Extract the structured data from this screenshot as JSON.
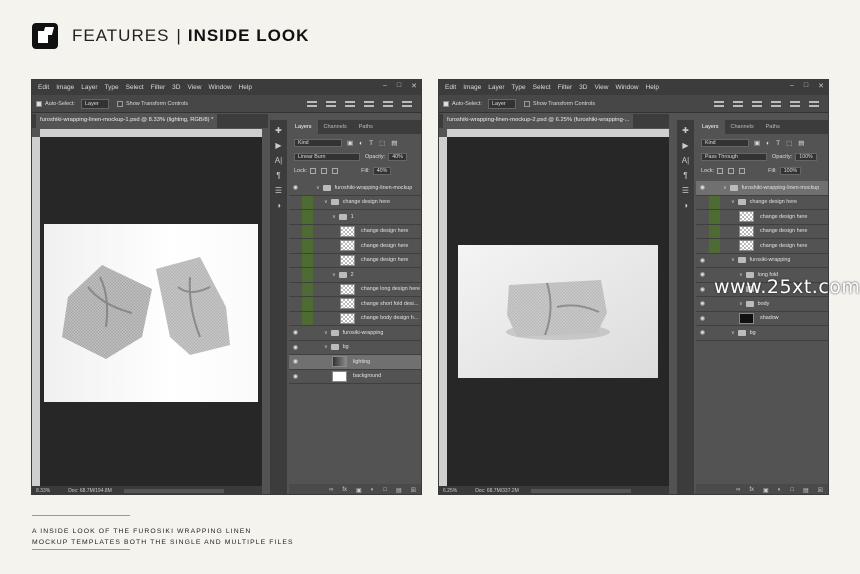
{
  "header": {
    "features": "FEATURES",
    "separator": "|",
    "inside_look": "INSIDE LOOK"
  },
  "menu": [
    "Edit",
    "Image",
    "Layer",
    "Type",
    "Select",
    "Filter",
    "3D",
    "View",
    "Window",
    "Help"
  ],
  "window_controls": [
    "–",
    "□",
    "✕"
  ],
  "options": {
    "auto_select": "Auto-Select:",
    "target": "Layer",
    "show_transform": "Show Transform Controls"
  },
  "panel_tabs": [
    "Layers",
    "Channels",
    "Paths"
  ],
  "filter_kind": "Kind",
  "lock_label": "Lock:",
  "fill_label": "Fill:",
  "opacity_label": "Opacity:",
  "window1": {
    "doc_tab": "furoshiki-wrapping-linen-mockup-1.psd @ 8.33% (lighting, RGB/8) *",
    "blend_mode": "Linear Burn",
    "opacity": "40%",
    "fill": "40%",
    "zoom": "8.33%",
    "doc_size": "Doc: 68.7M/194.8M",
    "layers": [
      {
        "name": "furoshiki-wrapping-linen-mockup",
        "type": "folder",
        "indent": 0,
        "eye": true
      },
      {
        "name": "change design here",
        "type": "folder",
        "indent": 1,
        "eye": false,
        "green": true
      },
      {
        "name": "1",
        "type": "folder",
        "indent": 2,
        "eye": false,
        "green": true
      },
      {
        "name": "change design here",
        "type": "smart",
        "indent": 3,
        "eye": false,
        "green": true
      },
      {
        "name": "change design here",
        "type": "smart",
        "indent": 3,
        "eye": false,
        "green": true
      },
      {
        "name": "change design here",
        "type": "smart",
        "indent": 3,
        "eye": false,
        "green": true
      },
      {
        "name": "2",
        "type": "folder",
        "indent": 2,
        "eye": false,
        "green": true
      },
      {
        "name": "change long design here",
        "type": "smart",
        "indent": 3,
        "eye": false,
        "green": true
      },
      {
        "name": "change short fold desi...",
        "type": "smart",
        "indent": 3,
        "eye": false,
        "green": true
      },
      {
        "name": "change body design h...",
        "type": "smart",
        "indent": 3,
        "eye": false,
        "green": true
      },
      {
        "name": "furosiki-wrapping",
        "type": "folder",
        "indent": 1,
        "eye": true
      },
      {
        "name": "bg",
        "type": "folder",
        "indent": 1,
        "eye": true
      },
      {
        "name": "lighting",
        "type": "dark",
        "indent": 2,
        "eye": true,
        "selected": true
      },
      {
        "name": "background",
        "type": "white",
        "indent": 2,
        "eye": true
      }
    ]
  },
  "window2": {
    "doc_tab": "furoshiki-wrapping-linen-mockup-2.psd @ 6.25% (furoshiki-wrapping-...",
    "blend_mode": "Pass Through",
    "opacity": "100%",
    "fill": "100%",
    "zoom": "6.25%",
    "doc_size": "Doc: 68.7M/337.2M",
    "layers": [
      {
        "name": "furoshiki-wrapping-linen-mockup",
        "type": "folder",
        "indent": 0,
        "eye": true,
        "selected": true
      },
      {
        "name": "change design here",
        "type": "folder",
        "indent": 1,
        "eye": false,
        "green": true
      },
      {
        "name": "change design here",
        "type": "smart",
        "indent": 2,
        "eye": false,
        "green": true
      },
      {
        "name": "change design here",
        "type": "smart",
        "indent": 2,
        "eye": false,
        "green": true
      },
      {
        "name": "change design here",
        "type": "smart",
        "indent": 2,
        "eye": false,
        "green": true
      },
      {
        "name": "furosiki-wrapping",
        "type": "folder",
        "indent": 1,
        "eye": true
      },
      {
        "name": "long fold",
        "type": "folder",
        "indent": 2,
        "eye": true
      },
      {
        "name": "",
        "type": "folder",
        "indent": 2,
        "eye": true
      },
      {
        "name": "body",
        "type": "folder",
        "indent": 2,
        "eye": true
      },
      {
        "name": "shadow",
        "type": "blk",
        "indent": 2,
        "eye": true
      },
      {
        "name": "bg",
        "type": "folder",
        "indent": 1,
        "eye": true
      }
    ]
  },
  "tools": [
    "✚",
    "▶",
    "A|",
    "¶",
    "☰",
    "◑"
  ],
  "panel_bottom_icons": [
    "∞",
    "fx",
    "▣",
    "◐",
    "□",
    "▤",
    "☒"
  ],
  "watermark": "www.25xt.com",
  "caption": [
    "A INSIDE LOOK OF THE FUROSIKI WRAPPING LINEN",
    "MOCKUP TEMPLATES BOTH THE SINGLE AND MULTIPLE FILES"
  ]
}
